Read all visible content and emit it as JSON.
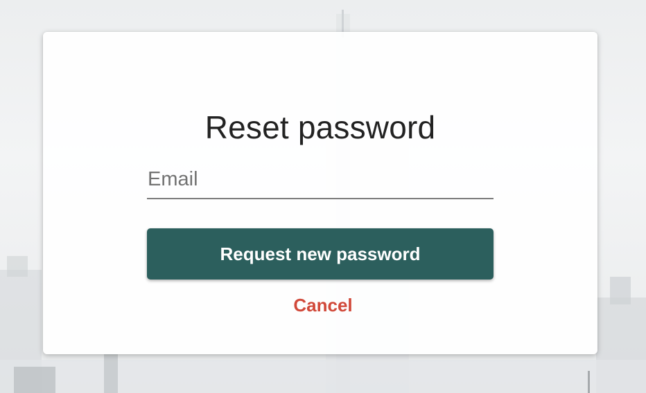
{
  "dialog": {
    "title": "Reset password",
    "email": {
      "placeholder": "Email",
      "value": ""
    },
    "submit_label": "Request new password",
    "cancel_label": "Cancel"
  },
  "colors": {
    "primary_button": "#2c5f5d",
    "cancel_link": "#d1493a",
    "title_text": "#222222"
  }
}
